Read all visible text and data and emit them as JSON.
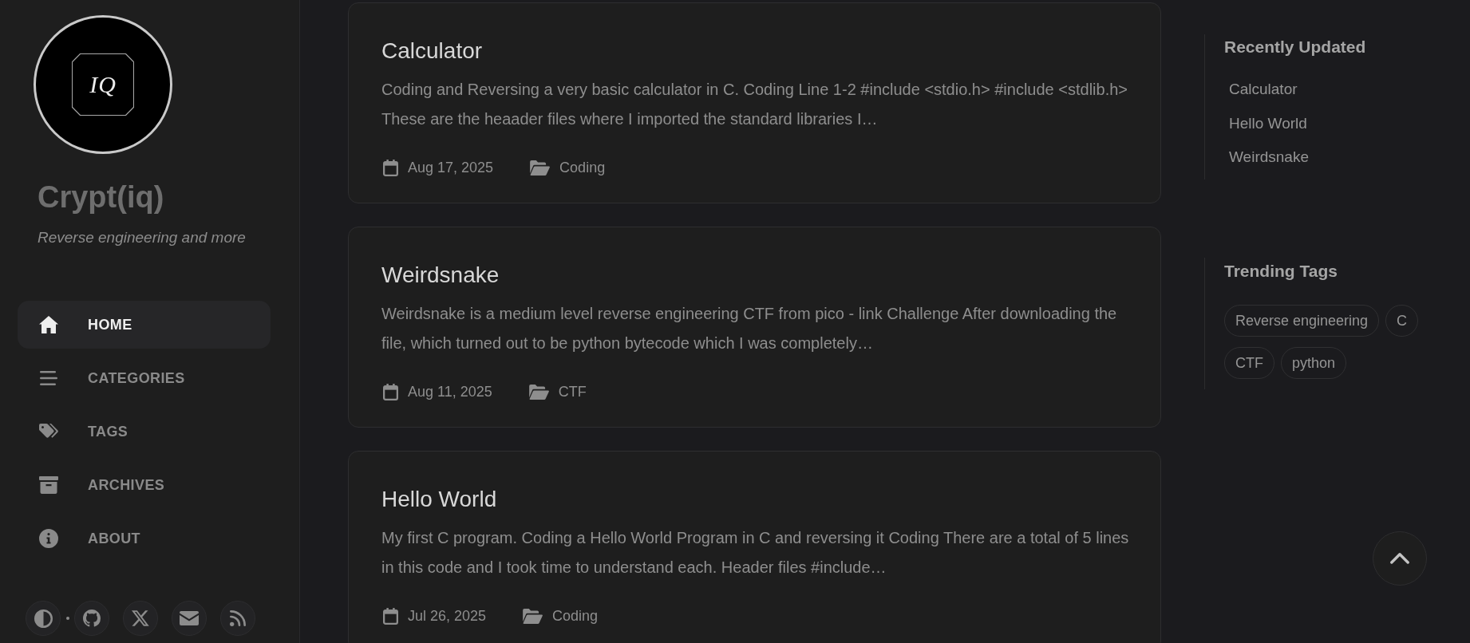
{
  "sidebar": {
    "avatar": {
      "monogram": "IQ"
    },
    "site_title": "Crypt(iq)",
    "tagline": "Reverse engineering and more",
    "nav": [
      {
        "kind": "home",
        "label": "HOME",
        "selected": true
      },
      {
        "kind": "categories",
        "label": "CATEGORIES",
        "selected": false
      },
      {
        "kind": "tags",
        "label": "TAGS",
        "selected": false
      },
      {
        "kind": "archives",
        "label": "ARCHIVES",
        "selected": false
      },
      {
        "kind": "about",
        "label": "ABOUT",
        "selected": false
      }
    ],
    "social": [
      {
        "kind": "theme"
      },
      {
        "kind": "github"
      },
      {
        "kind": "x"
      },
      {
        "kind": "email"
      },
      {
        "kind": "rss"
      }
    ]
  },
  "posts": [
    {
      "title": "Calculator",
      "excerpt": "Coding and Reversing a very basic calculator in C. Coding Line 1-2 #include <stdio.h> #include <stdlib.h> These are the heaader files where I imported the standard libraries I…",
      "date": "Aug 17, 2025",
      "category": "Coding"
    },
    {
      "title": "Weirdsnake",
      "excerpt": "Weirdsnake is a medium level reverse engineering CTF from pico - link Challenge After downloading the file, which turned out to be python bytecode which I was completely…",
      "date": "Aug 11, 2025",
      "category": "CTF"
    },
    {
      "title": "Hello World",
      "excerpt": "My first C program. Coding a Hello World Program in C and reversing it Coding There are a total of 5 lines in this code and I took time to understand each. Header files #include…",
      "date": "Jul 26, 2025",
      "category": "Coding"
    }
  ],
  "panels": {
    "recently_updated": {
      "title": "Recently Updated",
      "items": [
        "Calculator",
        "Hello World",
        "Weirdsnake"
      ]
    },
    "trending_tags": {
      "title": "Trending Tags",
      "tags": [
        "Reverse engineering",
        "C",
        "CTF",
        "python"
      ]
    }
  }
}
